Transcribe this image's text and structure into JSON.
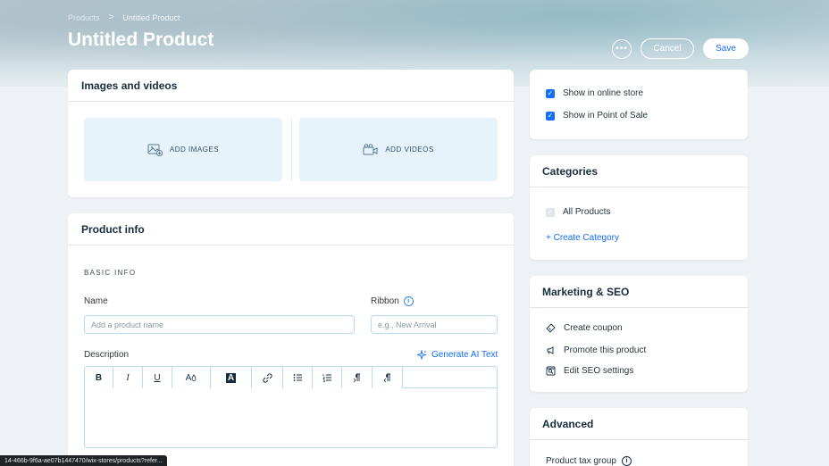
{
  "header": {
    "breadcrumb": {
      "parent": "Products",
      "separator": ">",
      "current": "Untitled Product"
    },
    "title": "Untitled Product",
    "more_label": "•••",
    "cancel_label": "Cancel",
    "save_label": "Save"
  },
  "media": {
    "title": "Images and videos",
    "add_images": "ADD IMAGES",
    "add_videos": "ADD VIDEOS"
  },
  "product_info": {
    "title": "Product info",
    "section": "BASIC INFO",
    "name_label": "Name",
    "name_placeholder": "Add a product name",
    "ribbon_label": "Ribbon",
    "ribbon_placeholder": "e.g., New Arrival",
    "description_label": "Description",
    "generate_ai": "Generate AI Text",
    "toolbar": [
      "B",
      "I",
      "U",
      "A",
      "A",
      "link",
      "bullets",
      "numbers",
      "ltr",
      "rtl"
    ]
  },
  "visibility": {
    "online_store": "Show in online store",
    "pos": "Show in Point of Sale"
  },
  "categories": {
    "title": "Categories",
    "all_products": "All Products",
    "create": "+ Create Category"
  },
  "marketing": {
    "title": "Marketing & SEO",
    "create_coupon": "Create coupon",
    "promote": "Promote this product",
    "seo": "Edit SEO settings"
  },
  "advanced": {
    "title": "Advanced",
    "tax_group": "Product tax group"
  },
  "status_url": "14-466b-9f6a-ae07b1447470/wix-stores/products?refer...",
  "colors": {
    "accent": "#116dff",
    "tile": "#e7f3fb"
  }
}
